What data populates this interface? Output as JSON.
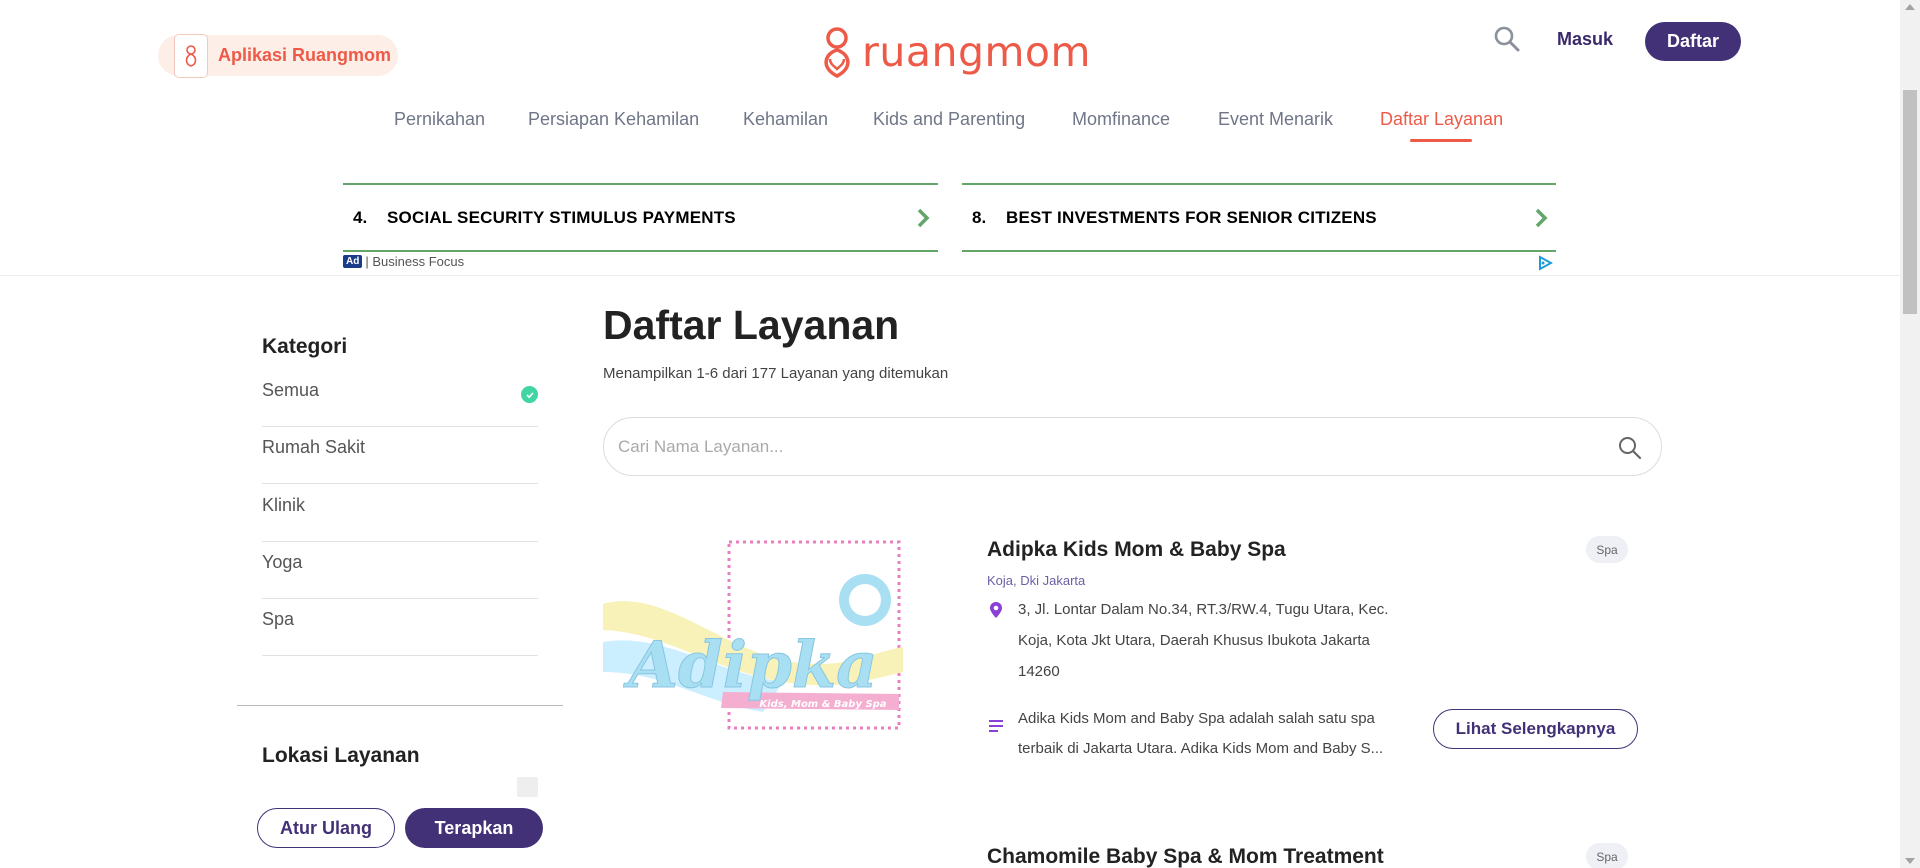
{
  "header": {
    "app_promo": "Aplikasi Ruangmom",
    "logo_text": "ruangmom",
    "login": "Masuk",
    "register": "Daftar"
  },
  "nav": {
    "items": [
      "Pernikahan",
      "Persiapan Kehamilan",
      "Kehamilan",
      "Kids and Parenting",
      "Momfinance",
      "Event Menarik",
      "Daftar Layanan"
    ],
    "active": "Daftar Layanan"
  },
  "ad": {
    "cards": [
      {
        "num": "4.",
        "text": "SOCIAL SECURITY STIMULUS PAYMENTS"
      },
      {
        "num": "8.",
        "text": "BEST INVESTMENTS FOR SENIOR CITIZENS"
      }
    ],
    "badge": "Ad",
    "source": "| Business Focus"
  },
  "sidebar": {
    "category_title": "Kategori",
    "categories": [
      "Semua",
      "Rumah Sakit",
      "Klinik",
      "Yoga",
      "Spa"
    ],
    "selected": "Semua",
    "location_title": "Lokasi Layanan",
    "reset": "Atur Ulang",
    "apply": "Terapkan"
  },
  "main": {
    "title": "Daftar Layanan",
    "result_count": "Menampilkan 1-6 dari 177 Layanan yang ditemukan",
    "search_placeholder": "Cari Nama Layanan...",
    "listings": [
      {
        "name": "Adipka Kids Mom & Baby Spa",
        "tag": "Spa",
        "location": "Koja, Dki Jakarta",
        "address": "3, Jl. Lontar Dalam No.34, RT.3/RW.4, Tugu Utara, Kec. Koja, Kota Jkt Utara, Daerah Khusus Ibukota Jakarta 14260",
        "description": "Adika Kids Mom and Baby Spa adalah salah satu spa terbaik di Jakarta Utara. Adika Kids Mom and Baby S...",
        "more": "Lihat Selengkapnya",
        "thumb_title": "Adipka",
        "thumb_subtitle": "Kids, Mom & Baby Spa"
      },
      {
        "name": "Chamomile Baby Spa & Mom Treatment",
        "tag": "Spa"
      }
    ]
  },
  "colors": {
    "brand": "#ee5a48",
    "primary": "#433177",
    "check": "#41d5a2",
    "ad_border": "#62a66a"
  }
}
